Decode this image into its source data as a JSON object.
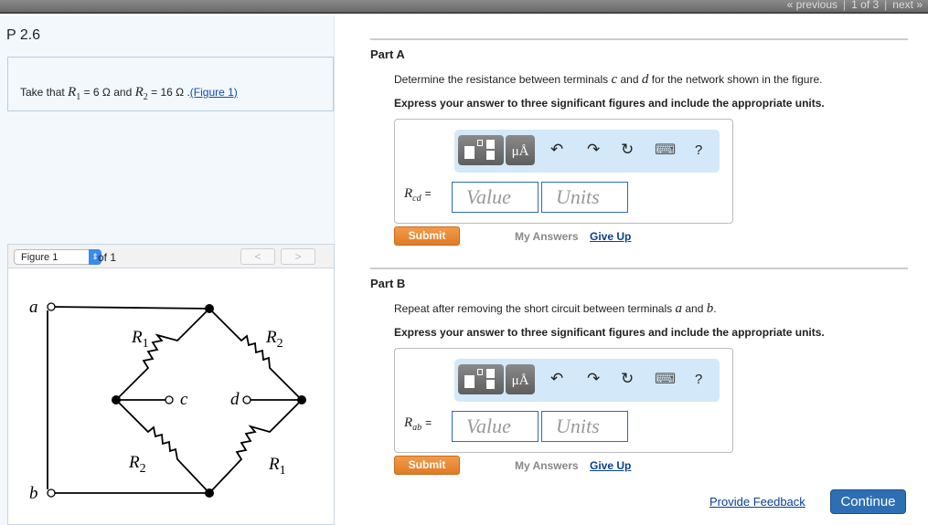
{
  "nav": {
    "previous": "« previous",
    "position": "1 of 3",
    "next": "next »"
  },
  "problem": {
    "title": "P 2.6",
    "intro": "Take that",
    "r1_sym": "R",
    "r1_sub": "1",
    "r1_val": "= 6 Ω and",
    "r2_sym": "R",
    "r2_sub": "2",
    "r2_val": "= 16 Ω .",
    "fig_link": "(Figure 1)"
  },
  "figure": {
    "select": "Figure 1",
    "of": "of 1",
    "prev": "<",
    "next": ">",
    "labels": {
      "a": "a",
      "b": "b",
      "c": "c",
      "d": "d",
      "r1": "R",
      "r2": "R",
      "s1": "1",
      "s2": "2"
    }
  },
  "toolbar": {
    "templates_icon": "templates-icon",
    "units_label": "μÅ",
    "undo": "↶",
    "redo": "↷",
    "reset": "↻",
    "keyboard": "⌨",
    "help": "?"
  },
  "partA": {
    "label": "Part A",
    "q_pre": "Determine the resistance between terminals",
    "c": "c",
    "and": "and",
    "d": "d",
    "q_post": "for the network shown in the figure.",
    "instr": "Express your answer to three significant figures and include the appropriate units.",
    "var": "R",
    "sub": "cd",
    "eq": "=",
    "value_ph": "Value",
    "units_ph": "Units",
    "submit": "Submit",
    "my_answers": "My Answers",
    "give_up": "Give Up"
  },
  "partB": {
    "label": "Part B",
    "q_pre": "Repeat after removing the short circuit between terminals",
    "a": "a",
    "and": "and",
    "b": "b",
    "q_post": ".",
    "instr": "Express your answer to three significant figures and include the appropriate units.",
    "var": "R",
    "sub": "ab",
    "eq": "=",
    "value_ph": "Value",
    "units_ph": "Units",
    "submit": "Submit",
    "my_answers": "My Answers",
    "give_up": "Give Up"
  },
  "footer": {
    "feedback": "Provide Feedback",
    "continue": "Continue"
  }
}
